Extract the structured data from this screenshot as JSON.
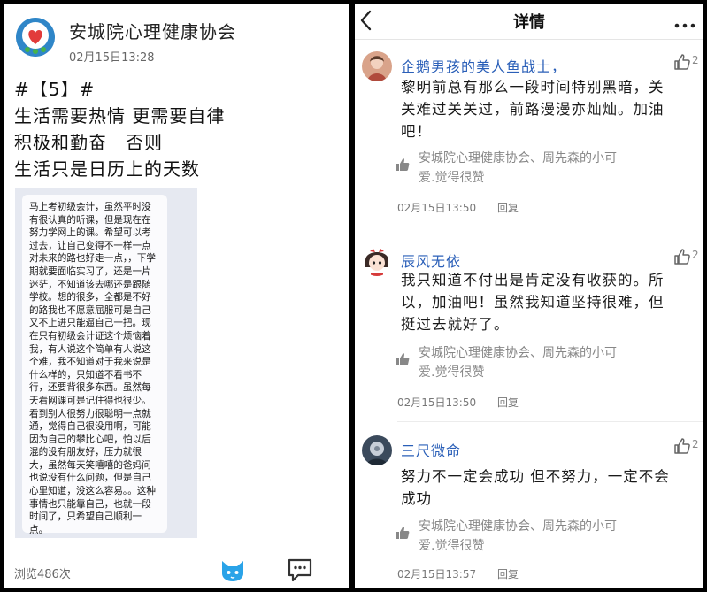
{
  "left": {
    "author": "安城院心理健康协会",
    "time": "02月15日13:28",
    "post_lines": [
      "#【5】#",
      "生活需要热情 更需要自律",
      "积极和勤奋　否则",
      "生活只是日历上的天数"
    ],
    "note_text": "马上考初级会计，虽然平时没有很认真的听课，但是现在在努力学网上的课。希望可以考过去，让自己变得不一样一点对未来的路也好走一点，，下学期就要面临实习了，还是一片迷茫，不知道该去哪还是跟随学校。想的很多，全都是不好的路我也不愿意屈服可是自己又不上进只能逼自己一把。现在只有初级会计证这个烦恼着我，有人说这个简单有人说这个难，我不知道对于我来说是什么样的，只知道不看书不行，还要背很多东西。虽然每天看网课可是记住得也很少。看到别人很努力很聪明一点就通，觉得自己很没用啊，可能因为自己的攀比心吧，怕以后混的没有朋友好，压力就很大，虽然每天笑嘻嘻的爸妈问也说没有什么问题，但是自己心里知道，没这么容易。。这种事情也只能靠自己，也就一段时间了，只希望自己顺利一点。",
    "view_count": "浏览486次",
    "icons": {
      "cat": "cat-icon",
      "comment": "comment-bubble-icon"
    },
    "accent": "#2f86c8"
  },
  "right": {
    "back_icon": "chevron-left-icon",
    "title": "详情",
    "more_icon": "more-dots-icon",
    "comments": [
      {
        "name": "企鹅男孩的美人鱼战士，",
        "like_count": "2",
        "text_lines": [
          "黎明前总有那么一段时间特别黑暗，关",
          "关难过关关过，前路漫漫亦灿灿。加油",
          "吧！"
        ],
        "likers_lines": [
          "安城院心理健康协会、周先森的小可",
          "爱.觉得很赞"
        ],
        "time": "02月15日13:50",
        "reply": "回复"
      },
      {
        "name": "辰风无依",
        "like_count": "2",
        "text_lines": [
          "我只知道不付出是肯定没有收获的。所",
          "以，加油吧！虽然我知道坚持很难，但",
          "挺过去就好了。"
        ],
        "likers_lines": [
          "安城院心理健康协会、周先森的小可",
          "爱.觉得很赞"
        ],
        "time": "02月15日13:50",
        "reply": "回复"
      },
      {
        "name": "三尺微命",
        "like_count": "2",
        "text_lines": [
          "努力不一定会成功 但不努力，一定不会",
          "成功"
        ],
        "likers_lines": [
          "安城院心理健康协会、周先森的小可",
          "爱.觉得很赞"
        ],
        "time": "02月15日13:57",
        "reply": "回复"
      }
    ],
    "name_color": "#2a5fb8"
  }
}
